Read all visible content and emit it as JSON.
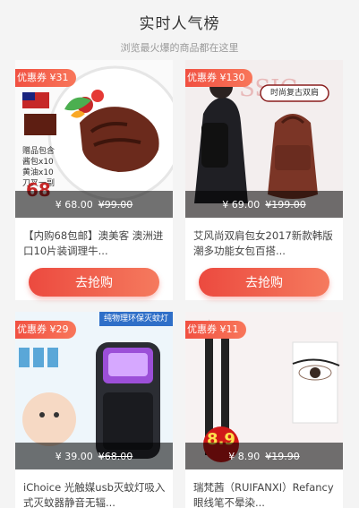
{
  "header": {
    "title": "实时人气榜",
    "subtitle": "浏览最火爆的商品都在这里"
  },
  "products": [
    {
      "coupon": "优惠券 ¥31",
      "price": "¥ 68.00",
      "old_price": "¥99.00",
      "name": "【内购68包邮】澳美客 澳洲进口10片装调理牛...",
      "buy": "去抢购"
    },
    {
      "coupon": "优惠券 ¥130",
      "price": "¥ 69.00",
      "old_price": "¥199.00",
      "name": "艾风尚双肩包女2017新款韩版潮多功能女包百搭...",
      "buy": "去抢购",
      "tag": "时尚复古双肩"
    },
    {
      "coupon": "优惠券 ¥29",
      "price": "¥ 39.00",
      "old_price": "¥68.00",
      "name": "iChoice 光触媒usb灭蚊灯吸入式灭蚊器静音无辐...",
      "tag": "纯物理环保灭蚊灯"
    },
    {
      "coupon": "优惠券 ¥11",
      "price": "¥ 8.90",
      "old_price": "¥19.90",
      "name": "瑞梵茜（RUIFANXI）Refancy眼线笔不晕染...",
      "badge": "8.9"
    }
  ]
}
